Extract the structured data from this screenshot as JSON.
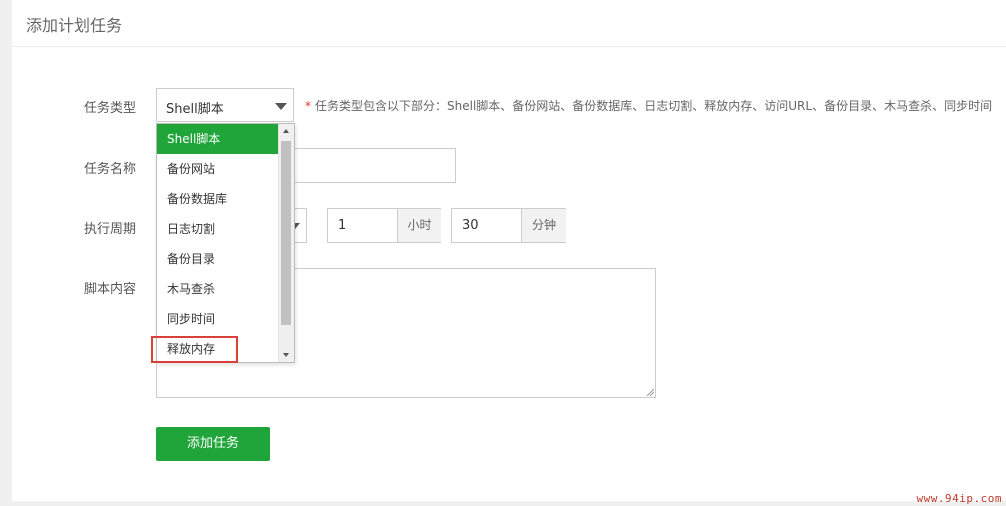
{
  "page": {
    "title": "添加计划任务"
  },
  "form": {
    "task_type": {
      "label": "任务类型",
      "value": "Shell脚本",
      "hint": "任务类型包含以下部分：Shell脚本、备份网站、备份数据库、日志切割、释放内存、访问URL、备份目录、木马查杀、同步时间",
      "hint_star": "*"
    },
    "task_name": {
      "label": "任务名称",
      "value": ""
    },
    "period": {
      "label": "执行周期",
      "hour_value": "1",
      "hour_unit": "小时",
      "minute_value": "30",
      "minute_unit": "分钟"
    },
    "script": {
      "label": "脚本内容",
      "value": ""
    },
    "submit_label": "添加任务"
  },
  "dropdown": {
    "options": [
      "Shell脚本",
      "备份网站",
      "备份数据库",
      "日志切割",
      "备份目录",
      "木马查杀",
      "同步时间",
      "释放内存"
    ],
    "selected_index": 0,
    "highlighted_option": "释放内存"
  },
  "colors": {
    "accent": "#20a53a",
    "highlight_border": "#d9403a"
  },
  "watermark": "www.94ip.com"
}
